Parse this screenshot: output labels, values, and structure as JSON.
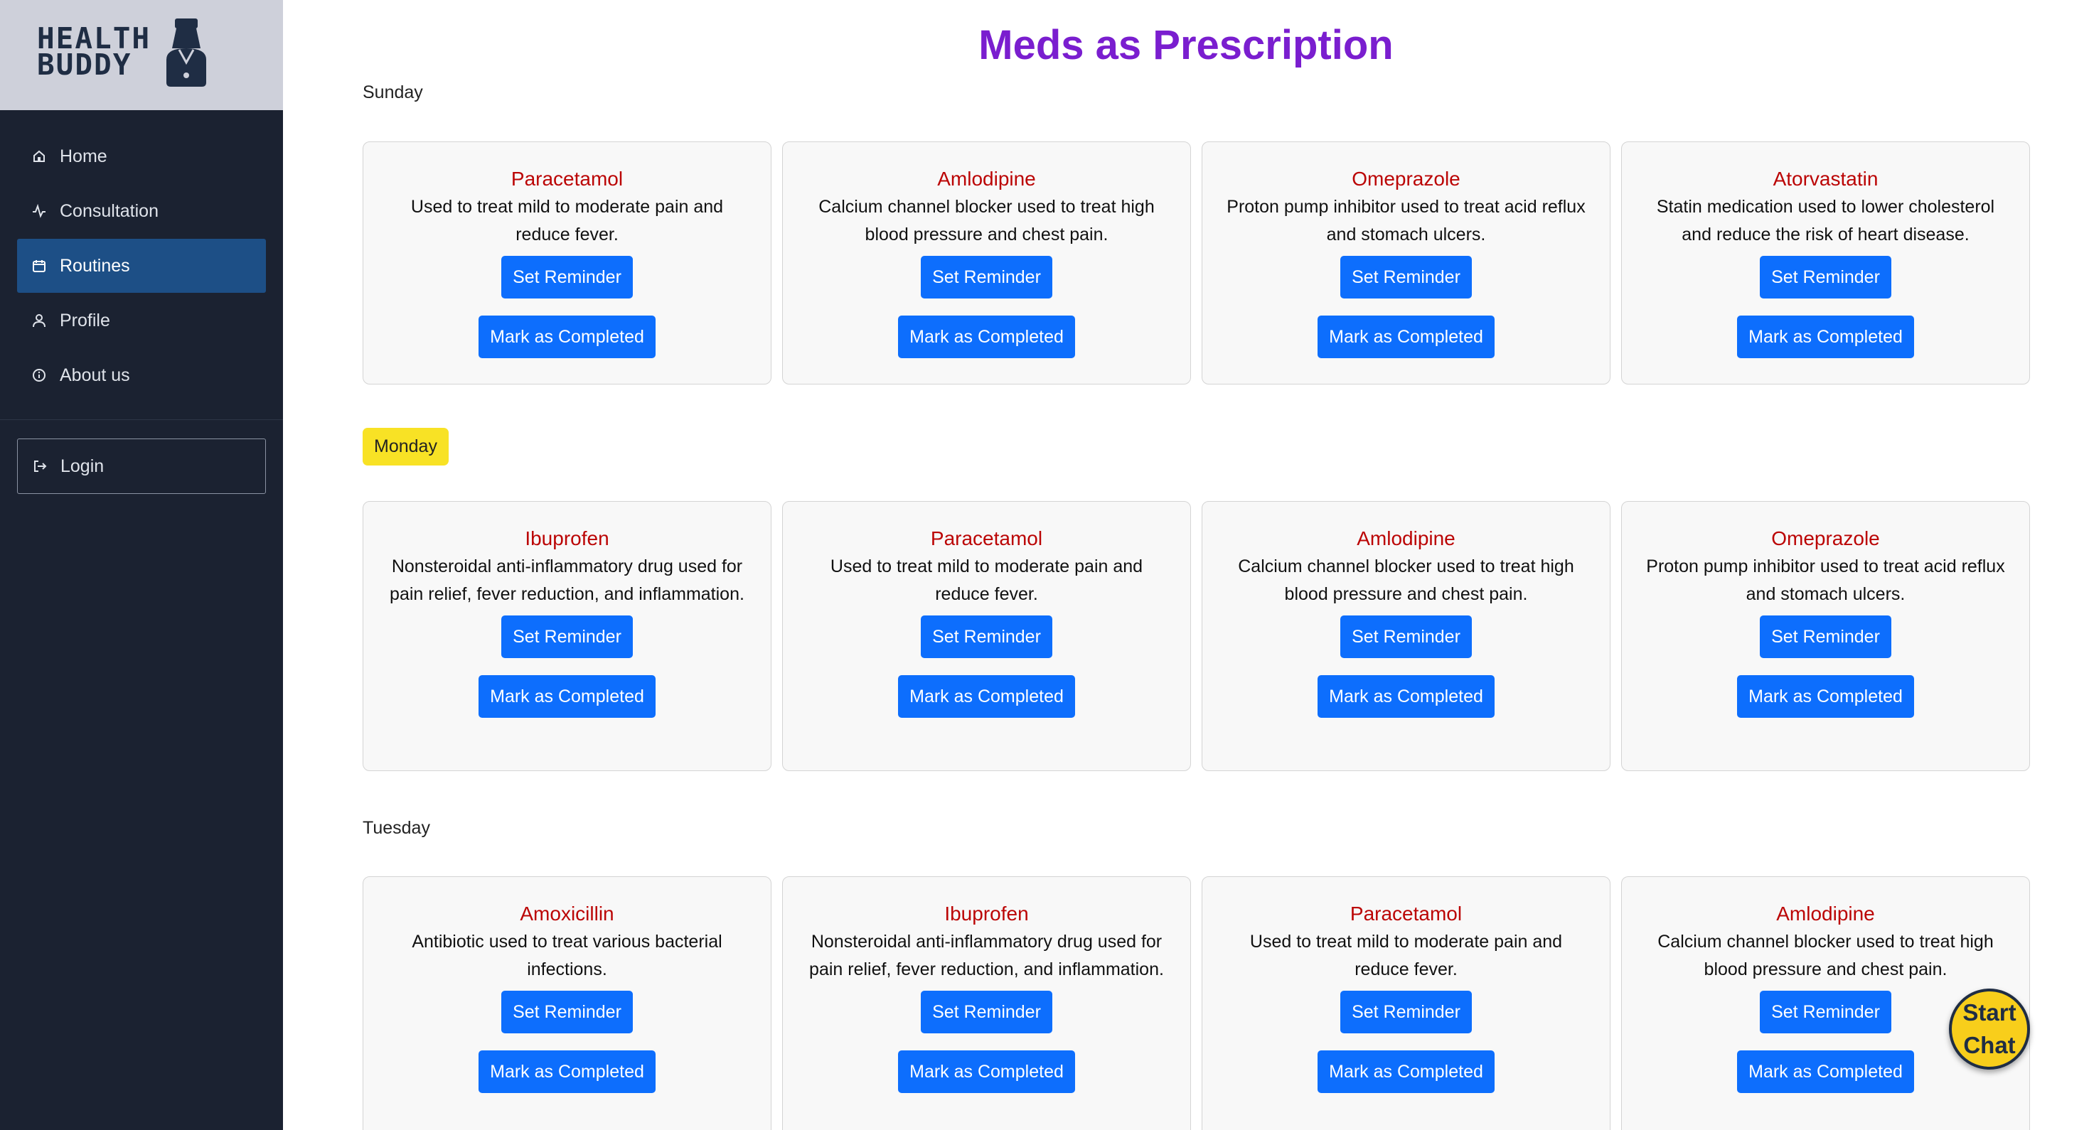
{
  "brand": {
    "line1": "HEALTH",
    "line2": "BUDDY"
  },
  "sidebar": {
    "items": [
      {
        "label": "Home",
        "icon": "home-icon"
      },
      {
        "label": "Consultation",
        "icon": "activity-icon"
      },
      {
        "label": "Routines",
        "icon": "calendar-icon",
        "active": true
      },
      {
        "label": "Profile",
        "icon": "user-icon"
      },
      {
        "label": "About us",
        "icon": "info-icon"
      }
    ],
    "login_label": "Login"
  },
  "page": {
    "title": "Meds as Prescription"
  },
  "buttons": {
    "reminder": "Set Reminder",
    "completed": "Mark as Completed"
  },
  "days": [
    {
      "label": "Sunday",
      "meds": [
        {
          "name": "Paracetamol",
          "desc": "Used to treat mild to moderate pain and reduce fever."
        },
        {
          "name": "Amlodipine",
          "desc": "Calcium channel blocker used to treat high blood pressure and chest pain."
        },
        {
          "name": "Omeprazole",
          "desc": "Proton pump inhibitor used to treat acid reflux and stomach ulcers."
        },
        {
          "name": "Atorvastatin",
          "desc": "Statin medication used to lower cholesterol and reduce the risk of heart disease."
        }
      ]
    },
    {
      "label": "Monday",
      "highlight": true,
      "meds": [
        {
          "name": "Ibuprofen",
          "desc": "Nonsteroidal anti-inflammatory drug used for pain relief, fever reduction, and inflammation."
        },
        {
          "name": "Paracetamol",
          "desc": "Used to treat mild to moderate pain and reduce fever."
        },
        {
          "name": "Amlodipine",
          "desc": "Calcium channel blocker used to treat high blood pressure and chest pain."
        },
        {
          "name": "Omeprazole",
          "desc": "Proton pump inhibitor used to treat acid reflux and stomach ulcers."
        }
      ]
    },
    {
      "label": "Tuesday",
      "meds": [
        {
          "name": "Amoxicillin",
          "desc": "Antibiotic used to treat various bacterial infections."
        },
        {
          "name": "Ibuprofen",
          "desc": "Nonsteroidal anti-inflammatory drug used for pain relief, fever reduction, and inflammation."
        },
        {
          "name": "Paracetamol",
          "desc": "Used to treat mild to moderate pain and reduce fever."
        },
        {
          "name": "Amlodipine",
          "desc": "Calcium channel blocker used to treat high blood pressure and chest pain."
        }
      ]
    }
  ],
  "chat": {
    "line1": "Start",
    "line2": "Chat"
  },
  "colors": {
    "sidebar": "#1b2231",
    "active": "#1d4f86",
    "title": "#7a1ecf",
    "medName": "#bb0505",
    "button": "#0d6efd",
    "highlight": "#f8e225",
    "chat": "#f8ce1b"
  }
}
